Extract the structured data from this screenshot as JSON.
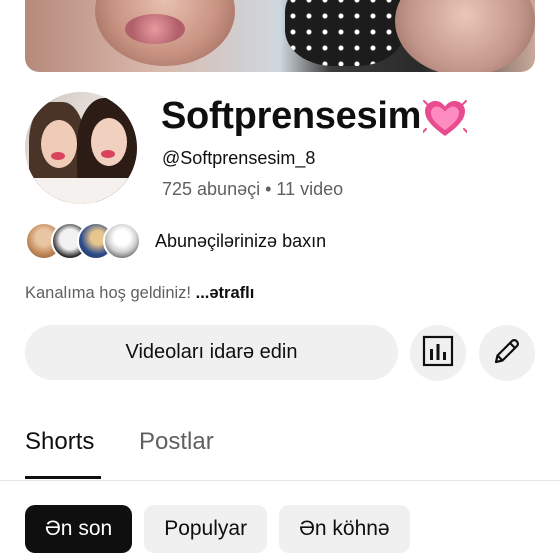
{
  "channel": {
    "name": "Softprensesim",
    "handle": "@Softprensesim_8",
    "stats": "725 abunəçi • 11 video",
    "subscribers_link": "Abunəçilərinizə baxın",
    "description": "Kanalıma hoş geldiniz!",
    "description_more": "...ətraflı"
  },
  "actions": {
    "manage_videos": "Videoları idarə edin",
    "analytics_icon": "analytics-icon",
    "edit_icon": "pencil-icon"
  },
  "tabs": [
    {
      "label": "Shorts",
      "active": true
    },
    {
      "label": "Postlar",
      "active": false
    }
  ],
  "filters": [
    {
      "label": "Ən son",
      "active": true
    },
    {
      "label": "Populyar",
      "active": false
    },
    {
      "label": "Ən köhnə",
      "active": false
    }
  ],
  "colors": {
    "accent_heart": "#e94b8f",
    "chip_active": "#0f0f0f",
    "secondary_text": "#606060"
  }
}
